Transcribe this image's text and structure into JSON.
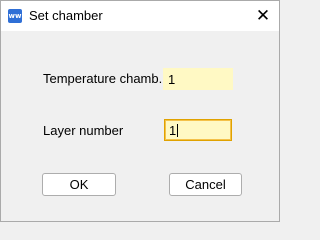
{
  "window": {
    "title": "Set chamber",
    "app_icon_text": "ww",
    "close_symbol": "✕"
  },
  "form": {
    "temperature_label": "Temperature chamb.",
    "temperature_value": "1",
    "layer_label": "Layer number",
    "layer_value": "1"
  },
  "buttons": {
    "ok_label": "OK",
    "cancel_label": "Cancel"
  },
  "colors": {
    "input_background": "#fff9c4",
    "focus_border": "#e0a200"
  }
}
